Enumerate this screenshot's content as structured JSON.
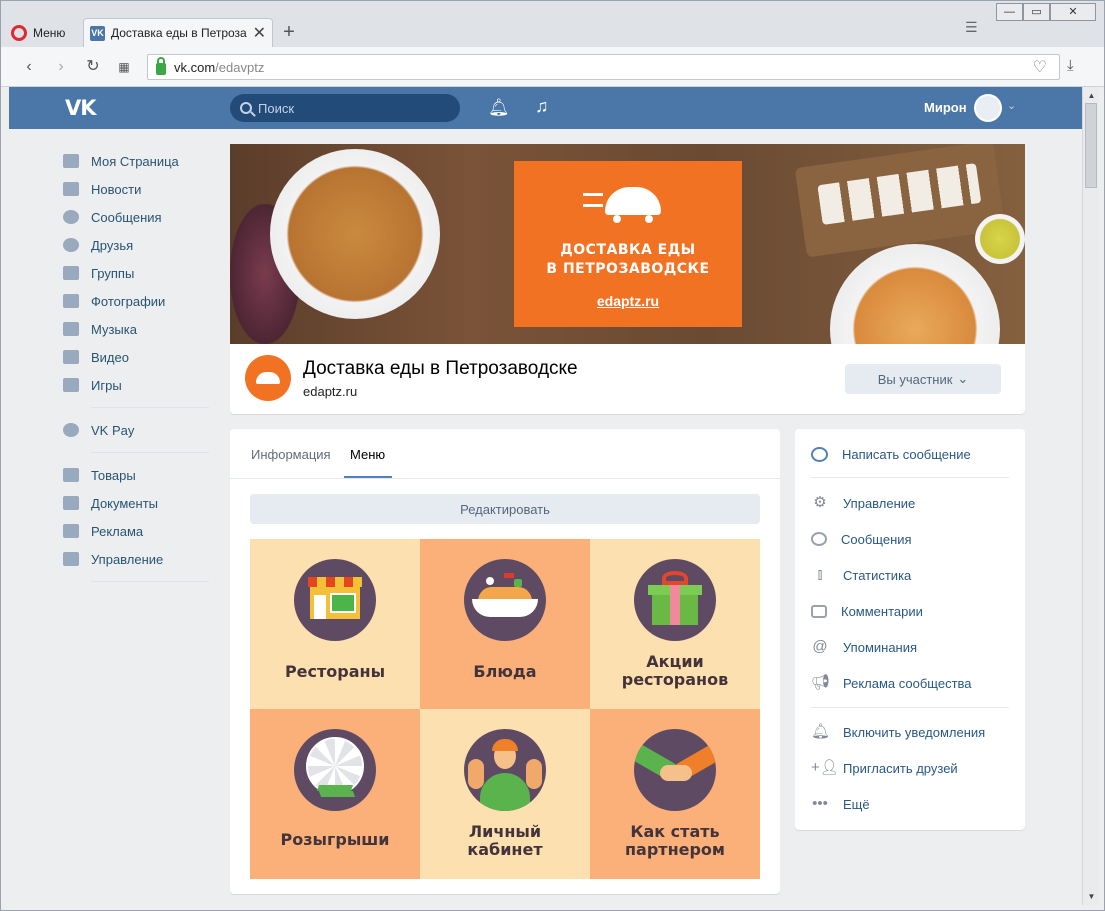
{
  "browser": {
    "menu_label": "Меню",
    "tab_title": "Доставка еды в Петрозавод",
    "tab_close": "✕",
    "new_tab": "+",
    "url_host": "vk.com",
    "url_path": "/edavptz",
    "window_controls": {
      "minimize": "—",
      "maximize": "▭",
      "close": "✕"
    }
  },
  "vk_header": {
    "logo": "VK",
    "search_placeholder": "Поиск",
    "user_name": "Мирон"
  },
  "left_nav": {
    "main": [
      "Моя Страница",
      "Новости",
      "Сообщения",
      "Друзья",
      "Группы",
      "Фотографии",
      "Музыка",
      "Видео",
      "Игры"
    ],
    "pay": "VK Pay",
    "extra": [
      "Товары",
      "Документы",
      "Реклама",
      "Управление"
    ]
  },
  "cover": {
    "title_line1": "ДОСТАВКА ЕДЫ",
    "title_line2": "В ПЕТРОЗАВОДСКЕ",
    "site": "edaptz.ru"
  },
  "group": {
    "title": "Доставка еды в Петрозаводске",
    "site": "edaptz.ru",
    "member_button": "Вы участник",
    "member_caret": "⌄"
  },
  "main_tabs": {
    "tabs": [
      "Информация",
      "Меню"
    ],
    "active": "Меню",
    "edit_button": "Редактировать"
  },
  "menu_grid": [
    {
      "line1": "Рестораны",
      "line2": ""
    },
    {
      "line1": "Блюда",
      "line2": ""
    },
    {
      "line1": "Акции",
      "line2": "ресторанов"
    },
    {
      "line1": "Розыгрыши",
      "line2": ""
    },
    {
      "line1": "Личный",
      "line2": "кабинет"
    },
    {
      "line1": "Как стать",
      "line2": "партнером"
    }
  ],
  "side_actions": {
    "primary": "Написать сообщение",
    "admin": [
      "Управление",
      "Сообщения",
      "Статистика",
      "Комментарии",
      "Упоминания",
      "Реклама сообщества"
    ],
    "other": [
      "Включить уведомления",
      "Пригласить друзей",
      "Ещё"
    ]
  },
  "colors": {
    "vk_blue": "#4a76a8",
    "promo_orange": "#f07222",
    "tile_light": "#fde0b0",
    "tile_dark": "#fbb07a"
  }
}
